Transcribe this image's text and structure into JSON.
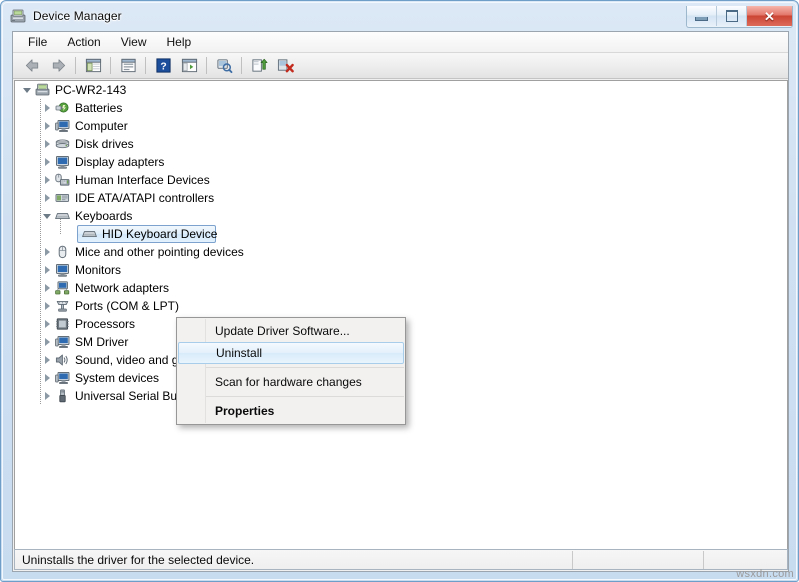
{
  "window": {
    "title": "Device Manager",
    "icon": "device-manager-icon",
    "controls": {
      "minimize": "Minimize",
      "maximize": "Restore",
      "close": "Close"
    }
  },
  "menu": {
    "items": [
      {
        "label": "File"
      },
      {
        "label": "Action"
      },
      {
        "label": "View"
      },
      {
        "label": "Help"
      }
    ]
  },
  "toolbar": {
    "buttons": [
      {
        "name": "back-icon",
        "title": "Back"
      },
      {
        "name": "forward-icon",
        "title": "Forward"
      },
      {
        "name": "show-hide-console-tree-icon",
        "title": "Show/Hide Console Tree"
      },
      {
        "name": "properties-icon",
        "title": "Properties"
      },
      {
        "name": "help-icon",
        "title": "Help"
      },
      {
        "name": "show-hide-action-pane-icon",
        "title": "Show/Hide Action Pane"
      },
      {
        "name": "scan-for-hardware-changes-icon",
        "title": "Scan for hardware changes"
      },
      {
        "name": "update-driver-icon",
        "title": "Update Driver Software"
      },
      {
        "name": "uninstall-device-icon",
        "title": "Uninstall"
      }
    ]
  },
  "tree": {
    "root": {
      "label": "PC-WR2-143",
      "icon": "computer-root-icon",
      "expanded": true
    },
    "nodes": [
      {
        "label": "Batteries",
        "icon": "battery-icon",
        "state": "collapsed",
        "depth": 1
      },
      {
        "label": "Computer",
        "icon": "computer-icon",
        "state": "collapsed",
        "depth": 1
      },
      {
        "label": "Disk drives",
        "icon": "disk-drive-icon",
        "state": "collapsed",
        "depth": 1
      },
      {
        "label": "Display adapters",
        "icon": "display-adapter-icon",
        "state": "collapsed",
        "depth": 1
      },
      {
        "label": "Human Interface Devices",
        "icon": "hid-icon",
        "state": "collapsed",
        "depth": 1
      },
      {
        "label": "IDE ATA/ATAPI controllers",
        "icon": "ide-controller-icon",
        "state": "collapsed",
        "depth": 1
      },
      {
        "label": "Keyboards",
        "icon": "keyboard-icon",
        "state": "expanded",
        "depth": 1
      },
      {
        "label": "HID Keyboard Device",
        "icon": "keyboard-device-icon",
        "state": "leaf",
        "depth": 2,
        "selected": true
      },
      {
        "label": "Mice and other pointing devices",
        "icon": "mouse-icon",
        "state": "collapsed",
        "depth": 1
      },
      {
        "label": "Monitors",
        "icon": "monitor-icon",
        "state": "collapsed",
        "depth": 1
      },
      {
        "label": "Network adapters",
        "icon": "network-adapter-icon",
        "state": "collapsed",
        "depth": 1
      },
      {
        "label": "Ports (COM & LPT)",
        "icon": "port-icon",
        "state": "collapsed",
        "depth": 1
      },
      {
        "label": "Processors",
        "icon": "processor-icon",
        "state": "collapsed",
        "depth": 1
      },
      {
        "label": "SM Driver",
        "icon": "sm-driver-icon",
        "state": "collapsed",
        "depth": 1
      },
      {
        "label": "Sound, video and game controllers",
        "icon": "sound-icon",
        "state": "collapsed",
        "depth": 1
      },
      {
        "label": "System devices",
        "icon": "system-device-icon",
        "state": "collapsed",
        "depth": 1
      },
      {
        "label": "Universal Serial Bus controllers",
        "icon": "usb-icon",
        "state": "collapsed",
        "depth": 1
      }
    ]
  },
  "context_menu": {
    "items": [
      {
        "label": "Update Driver Software...",
        "style": "normal",
        "highlighted": false
      },
      {
        "label": "Uninstall",
        "style": "normal",
        "highlighted": true
      },
      {
        "separator": true
      },
      {
        "label": "Scan for hardware changes",
        "style": "normal",
        "highlighted": false
      },
      {
        "separator": true
      },
      {
        "label": "Properties",
        "style": "bold",
        "highlighted": false
      }
    ]
  },
  "status_bar": {
    "text": "Uninstalls the driver for the selected device."
  },
  "watermark": {
    "text": "wsxdn.com"
  },
  "colors": {
    "frame": "#cfe0f2",
    "selection_border": "#7da2ce",
    "highlight": "#d8ebfa",
    "close_button": "#cc4535"
  }
}
